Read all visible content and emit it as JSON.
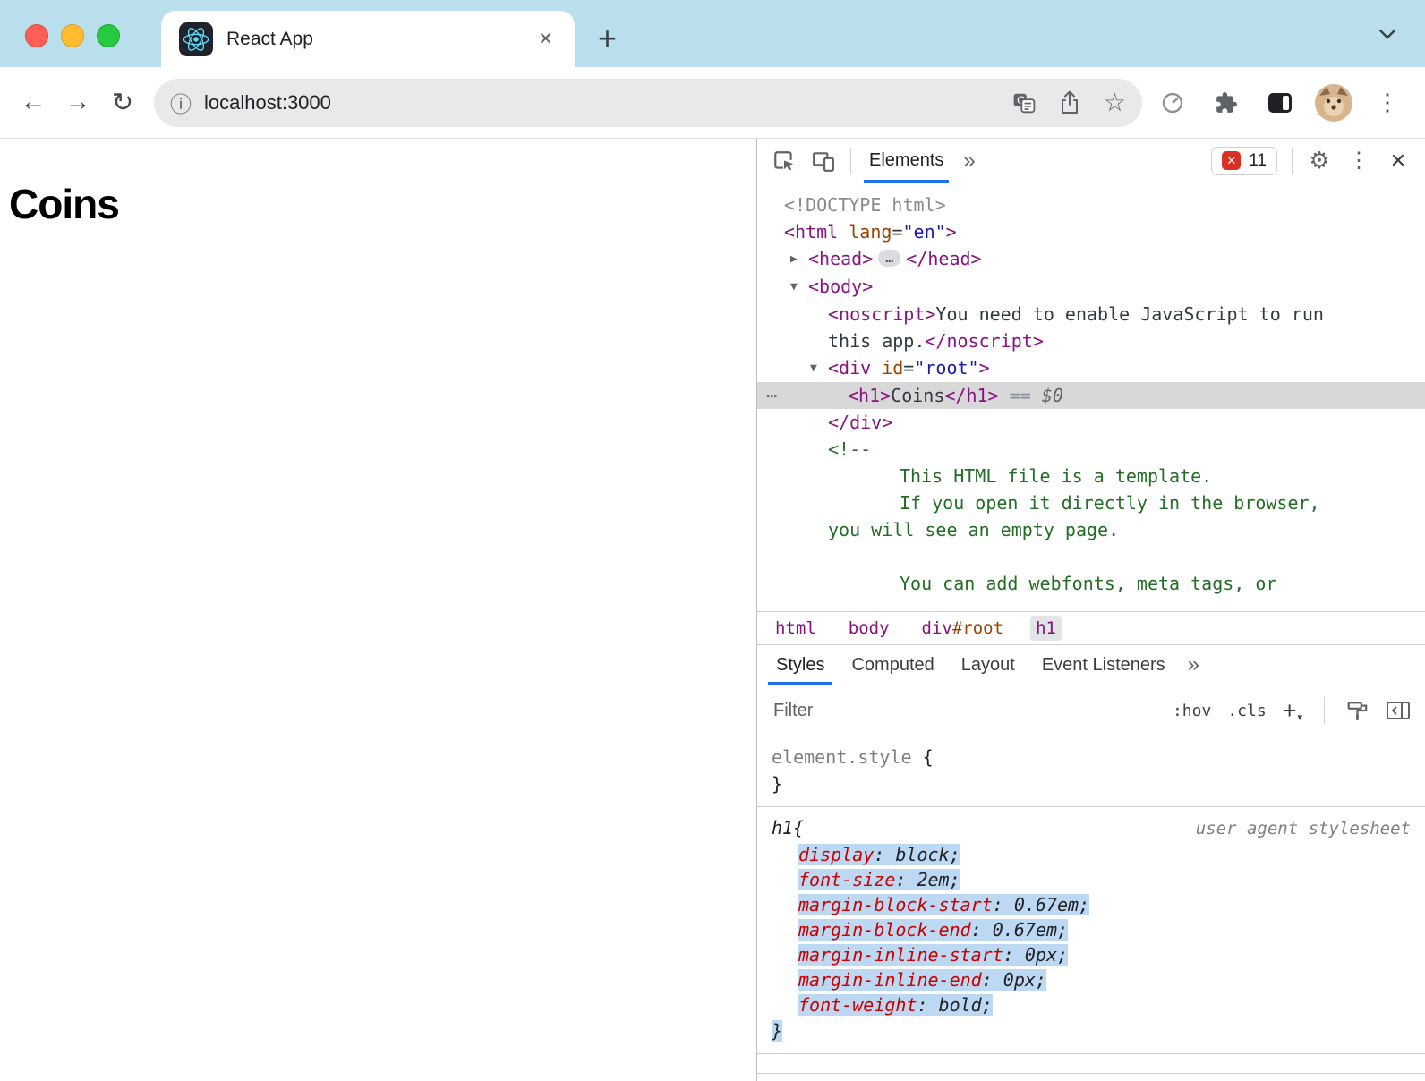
{
  "browser": {
    "tab_title": "React App",
    "url": "localhost:3000"
  },
  "page": {
    "heading": "Coins"
  },
  "devtools": {
    "header": {
      "elements_tab": "Elements",
      "error_count": "11"
    },
    "dom_lines": [
      {
        "indent": 30,
        "tokens": [
          {
            "c": "doc",
            "s": "<!DOCTYPE html>"
          }
        ]
      },
      {
        "indent": 30,
        "tokens": [
          {
            "c": "tag",
            "s": "<html"
          },
          {
            "c": "attr",
            "s": " lang"
          },
          {
            "c": "pun",
            "s": "="
          },
          {
            "c": "val",
            "s": "\"en\""
          },
          {
            "c": "tag",
            "s": ">"
          }
        ]
      },
      {
        "indent": 57,
        "arrow": "▶",
        "tokens": [
          {
            "c": "tag",
            "s": "<head>"
          },
          {
            "c": "pill",
            "s": "…"
          },
          {
            "c": "tag",
            "s": "</head>"
          }
        ]
      },
      {
        "indent": 57,
        "arrow": "▼",
        "tokens": [
          {
            "c": "tag",
            "s": "<body>"
          }
        ]
      },
      {
        "indent": 79,
        "tokens": [
          {
            "c": "tag",
            "s": "<noscript>"
          },
          {
            "c": "txt",
            "s": "You need to enable JavaScript to run"
          }
        ]
      },
      {
        "indent": 79,
        "tokens": [
          {
            "c": "txt",
            "s": "this app."
          },
          {
            "c": "tag",
            "s": "</noscript>"
          }
        ]
      },
      {
        "indent": 79,
        "arrow": "▼",
        "tokens": [
          {
            "c": "tag",
            "s": "<div"
          },
          {
            "c": "attr",
            "s": " id"
          },
          {
            "c": "pun",
            "s": "="
          },
          {
            "c": "val",
            "s": "\"root\""
          },
          {
            "c": "tag",
            "s": ">"
          }
        ]
      },
      {
        "indent": 101,
        "selected": true,
        "tokens": [
          {
            "c": "tag",
            "s": "<h1>"
          },
          {
            "c": "txt",
            "s": "Coins"
          },
          {
            "c": "tag",
            "s": "</h1>"
          },
          {
            "c": "eq",
            "s": " == "
          },
          {
            "c": "dol",
            "s": "$0"
          }
        ]
      },
      {
        "indent": 79,
        "tokens": [
          {
            "c": "tag",
            "s": "</div>"
          }
        ]
      },
      {
        "indent": 79,
        "tokens": [
          {
            "c": "com",
            "s": "<!--"
          }
        ]
      },
      {
        "indent": 159,
        "tokens": [
          {
            "c": "com",
            "s": "This HTML file is a template."
          }
        ]
      },
      {
        "indent": 159,
        "tokens": [
          {
            "c": "com",
            "s": "If you open it directly in the browser,"
          }
        ]
      },
      {
        "indent": 79,
        "tokens": [
          {
            "c": "com",
            "s": "you will see an empty page."
          }
        ]
      },
      {
        "indent": 79,
        "tokens": []
      },
      {
        "indent": 159,
        "tokens": [
          {
            "c": "com",
            "s": "You can add webfonts, meta tags, or"
          }
        ]
      }
    ],
    "breadcrumbs": [
      {
        "parts": [
          {
            "c": "tag",
            "s": "html"
          }
        ]
      },
      {
        "parts": [
          {
            "c": "tag",
            "s": "body"
          }
        ]
      },
      {
        "parts": [
          {
            "c": "tag",
            "s": "div"
          },
          {
            "c": "attr",
            "s": "#root"
          }
        ]
      },
      {
        "parts": [
          {
            "c": "tag",
            "s": "h1"
          }
        ],
        "active": true
      }
    ],
    "panel_tabs": [
      {
        "label": "Styles",
        "active": true
      },
      {
        "label": "Computed"
      },
      {
        "label": "Layout"
      },
      {
        "label": "Event Listeners"
      }
    ],
    "filter": {
      "placeholder": "Filter",
      "hov": ":hov",
      "cls": ".cls"
    },
    "styles": {
      "element_style_selector": "element.style",
      "rule_selector": "h1",
      "rule_source": "user agent stylesheet",
      "properties": [
        {
          "name": "display",
          "value": "block"
        },
        {
          "name": "font-size",
          "value": "2em"
        },
        {
          "name": "margin-block-start",
          "value": "0.67em"
        },
        {
          "name": "margin-block-end",
          "value": "0.67em"
        },
        {
          "name": "margin-inline-start",
          "value": "0px"
        },
        {
          "name": "margin-inline-end",
          "value": "0px"
        },
        {
          "name": "font-weight",
          "value": "bold"
        }
      ]
    }
  },
  "colors": {
    "tabstrip_blue": "#b8dfeb",
    "accent_blue": "#1a73e8",
    "error_red": "#d93025",
    "tag_purple": "#881280",
    "attr_orange": "#994500",
    "value_blue": "#1a1aa6",
    "comment_green": "#236e25",
    "property_red": "#c80000",
    "selection_gray": "#d8d8d8",
    "selection_blue": "#bdd8f2",
    "react_cyan": "#61dafb"
  }
}
